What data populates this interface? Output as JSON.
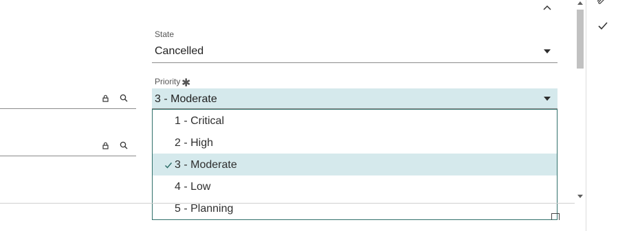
{
  "form": {
    "state": {
      "label": "State",
      "value": "Cancelled"
    },
    "priority": {
      "label": "Priority",
      "required_marker": "✱",
      "value": "3 - Moderate",
      "options": [
        {
          "label": "1 - Critical",
          "selected": false
        },
        {
          "label": "2 - High",
          "selected": false
        },
        {
          "label": "3 - Moderate",
          "selected": true
        },
        {
          "label": "4 - Low",
          "selected": false
        },
        {
          "label": "5 - Planning",
          "selected": false
        }
      ]
    }
  },
  "icons": {
    "reference_lock": "lock-icon",
    "reference_search": "search-icon",
    "collapse": "chevron-up-icon",
    "attach": "paperclip-icon",
    "confirm": "checkmark-icon",
    "selected_option": "checkmark-icon"
  },
  "colors": {
    "selected_background": "#d5e9ec",
    "dropdown_border": "#2f6f6a",
    "check_color": "#2f6f6a"
  }
}
